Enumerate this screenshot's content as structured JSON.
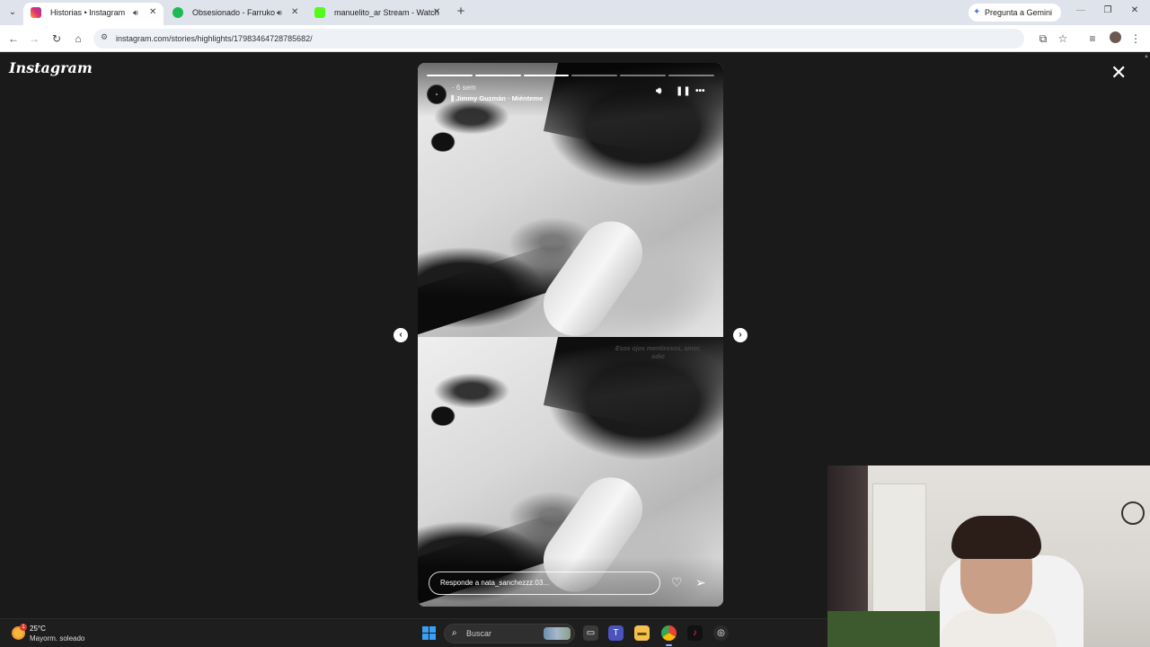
{
  "browser": {
    "tabs": [
      {
        "title": "Historias • Instagram",
        "active": true,
        "audio": true,
        "favicon": "instagram-icon",
        "color": "#e1306c"
      },
      {
        "title": "Obsesionado - Farruko",
        "active": false,
        "audio": true,
        "favicon": "spotify-icon",
        "color": "#1db954"
      },
      {
        "title": "manuelito_ar Stream - Watch Li",
        "active": false,
        "audio": false,
        "favicon": "kick-icon",
        "color": "#53fc18"
      }
    ],
    "new_tab_symbol": "+",
    "gemini_label": "Pregunta a Gemini",
    "url": "instagram.com/stories/highlights/17983464728785682/"
  },
  "instagram": {
    "logo_text": "Instagram",
    "close_symbol": "✕",
    "story": {
      "segments_total": 6,
      "segments_done": 3,
      "time_ago": "6 sem",
      "music": "Jimmy Guzmán · Miénteme",
      "caption": "Esos ojos mentirosos, amor, odio",
      "reply_placeholder": "Responde a nata_sanchezzz.03..."
    },
    "prev_symbol": "‹",
    "next_symbol": "›"
  },
  "taskbar": {
    "weather_temp": "25°C",
    "weather_desc": "Mayorm. soleado",
    "weather_badge": "1",
    "search_placeholder": "Buscar"
  }
}
